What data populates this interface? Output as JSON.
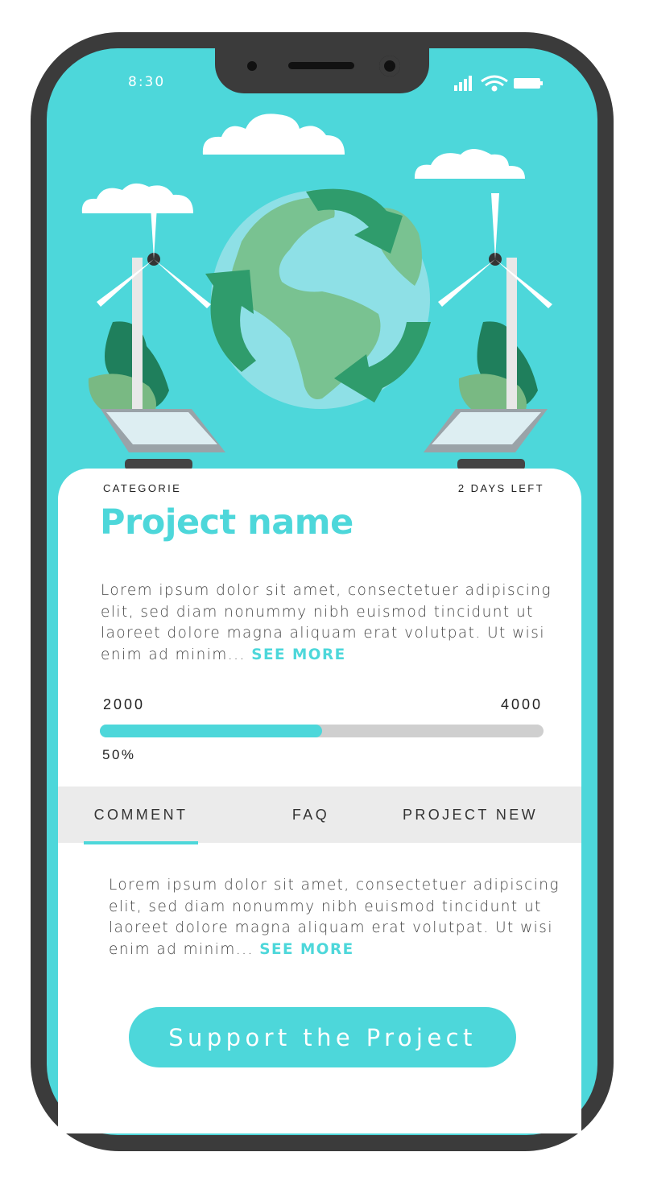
{
  "status_bar": {
    "time": "8:30",
    "icons": [
      "signal-icon",
      "wifi-icon",
      "battery-icon"
    ]
  },
  "hero": {
    "illustration": "renewable-energy-globe-illustration"
  },
  "project": {
    "category": "CATEGORIE",
    "days_left": "2 DAYS LEFT",
    "title": "Project name",
    "description": "Lorem ipsum dolor sit amet, consectetuer adipiscing elit, sed diam nonummy nibh euismod tincidunt ut laoreet dolore magna aliquam erat volutpat. Ut wisi enim ad minim...",
    "see_more": "SEE MORE"
  },
  "funding": {
    "raised": "2000",
    "goal": "4000",
    "percent_label": "50%",
    "progress": 0.5
  },
  "tabs": [
    {
      "label": "COMMENT",
      "active": true
    },
    {
      "label": "FAQ",
      "active": false
    },
    {
      "label": "PROJECT NEW",
      "active": false
    }
  ],
  "tab_content": {
    "text": "Lorem ipsum dolor sit amet, consectetuer adipiscing elit, sed diam nonummy nibh euismod tincidunt ut laoreet dolore magna aliquam erat volutpat. Ut wisi enim ad minim...",
    "see_more": "SEE MORE"
  },
  "cta": {
    "label": "Support the Project"
  },
  "colors": {
    "accent": "#4dd7da",
    "phone_frame": "#3b3b3b",
    "track": "#cfcfcf",
    "tab_bar": "#ebebeb"
  }
}
